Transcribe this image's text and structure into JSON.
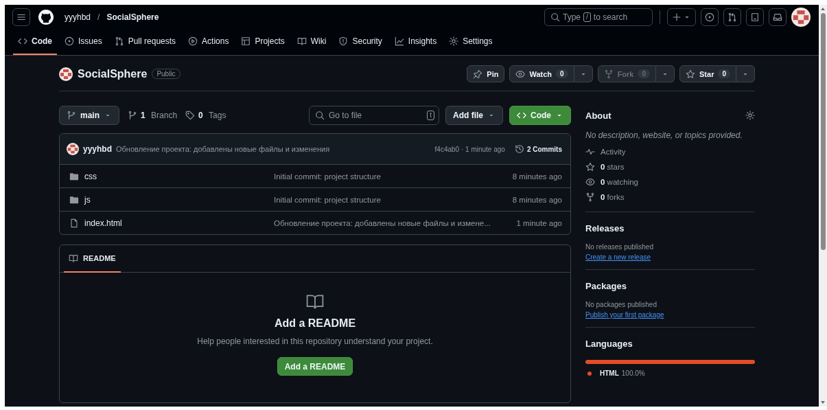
{
  "header": {
    "owner": "yyyhbd",
    "separator": "/",
    "repo": "SocialSphere",
    "search": {
      "prefix": "Type",
      "key": "/",
      "suffix": "to search"
    }
  },
  "tabs": [
    {
      "label": "Code",
      "selected": true
    },
    {
      "label": "Issues",
      "selected": false
    },
    {
      "label": "Pull requests",
      "selected": false
    },
    {
      "label": "Actions",
      "selected": false
    },
    {
      "label": "Projects",
      "selected": false
    },
    {
      "label": "Wiki",
      "selected": false
    },
    {
      "label": "Security",
      "selected": false
    },
    {
      "label": "Insights",
      "selected": false
    },
    {
      "label": "Settings",
      "selected": false
    }
  ],
  "repo": {
    "name": "SocialSphere",
    "visibility": "Public",
    "actions": [
      {
        "label": "Pin",
        "disabled": false
      },
      {
        "label": "Watch",
        "count": "0",
        "disabled": false,
        "menu": true
      },
      {
        "label": "Fork",
        "count": "0",
        "disabled": true,
        "menu": true
      },
      {
        "label": "Star",
        "count": "0",
        "disabled": false,
        "menu": true
      }
    ]
  },
  "toolbar": {
    "branch": "main",
    "branches": {
      "count": "1",
      "label": "Branch"
    },
    "tags": {
      "count": "0",
      "label": "Tags"
    },
    "file_search": {
      "placeholder": "Go to file",
      "key": "t"
    },
    "add_file": "Add file",
    "code": "Code"
  },
  "commit": {
    "author": "yyyhbd",
    "message": "Обновление проекта: добавлены новые файлы и изменения",
    "hash_time": "f4c4ab0 · 1 minute ago",
    "commits": "2 Commits"
  },
  "files": [
    {
      "kind": "folder",
      "name": "css",
      "message": "Initial commit: project structure",
      "time": "8 minutes ago"
    },
    {
      "kind": "folder",
      "name": "js",
      "message": "Initial commit: project structure",
      "time": "8 minutes ago"
    },
    {
      "kind": "file",
      "name": "index.html",
      "message": "Обновление проекта: добавлены новые файлы и измене...",
      "time": "1 minute ago"
    }
  ],
  "readme": {
    "tab": "README",
    "title": "Add a README",
    "description": "Help people interested in this repository understand your project.",
    "button": "Add a README"
  },
  "about": {
    "title": "About",
    "description": "No description, website, or topics provided.",
    "stats": [
      {
        "label": "Activity"
      },
      {
        "count": "0",
        "label": "stars"
      },
      {
        "count": "0",
        "label": "watching"
      },
      {
        "count": "0",
        "label": "forks"
      }
    ]
  },
  "releases": {
    "title": "Releases",
    "note": "No releases published",
    "link": "Create a new release"
  },
  "packages": {
    "title": "Packages",
    "note": "No packages published",
    "link": "Publish your first package"
  },
  "languages": {
    "title": "Languages",
    "items": [
      {
        "name": "HTML",
        "percent": "100.0%",
        "level": 1.0,
        "color": "#e34c26"
      }
    ]
  }
}
